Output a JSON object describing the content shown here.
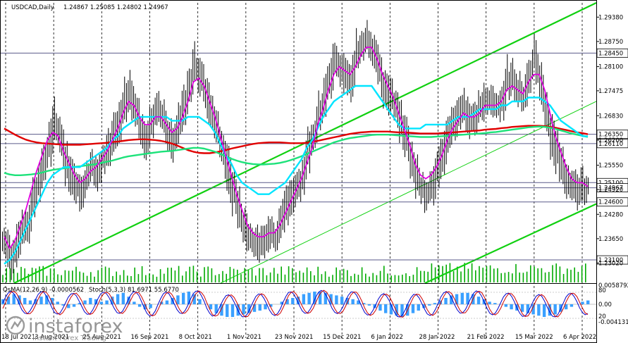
{
  "header": {
    "symbol": "USDCAD,Daily",
    "ohlc": "1.24867 1.25085 1.24802 1.24967"
  },
  "indicator_header": {
    "osma": "OsMA(12,26,9) -0.0000562",
    "stoch": "Stoch(5,3,3) 81.6971 55.6770"
  },
  "watermark": {
    "brand": "instaforex",
    "tagline": "Instant Forex Trading"
  },
  "colors": {
    "price_bar": "#000000",
    "ema_fast": "#e000e0",
    "ema_mid": "#00e5ff",
    "ema_slow_green": "#1de27a",
    "ema_200": "#e00000",
    "channel": "#10d010",
    "volume": "#00aa00",
    "osma": "#3aa0ff",
    "stoch_main": "#0000cc",
    "stoch_signal": "#d00000",
    "level_line": "#5a5a8a"
  },
  "chart_data": {
    "type": "candlestick",
    "title": "USDCAD,Daily",
    "ylim": [
      1.225,
      1.2975
    ],
    "y_ticks": [
      "1.29380",
      "1.28750",
      "1.28100",
      "1.27475",
      "1.26830",
      "1.26200",
      "1.25550",
      "1.24920",
      "1.24280",
      "1.23650",
      "1.23020"
    ],
    "level_labels": [
      "1.28450",
      "1.26350",
      "1.26110",
      "1.25100",
      "1.24967",
      "1.24600",
      "1.23100"
    ],
    "x_ticks": [
      "18 Jul 2021",
      "3 Aug 2021",
      "25 Aug 2021",
      "16 Sep 2021",
      "8 Oct 2021",
      "1 Nov 2021",
      "23 Nov 2021",
      "15 Dec 2021",
      "6 Jan 2022",
      "28 Jan 2022",
      "21 Feb 2022",
      "15 Mar 2022",
      "6 Apr 2022"
    ],
    "price_path": [
      1.236,
      1.231,
      1.234,
      1.238,
      1.24,
      1.246,
      1.25,
      1.255,
      1.26,
      1.266,
      1.264,
      1.258,
      1.253,
      1.251,
      1.248,
      1.252,
      1.255,
      1.254,
      1.257,
      1.26,
      1.263,
      1.266,
      1.271,
      1.274,
      1.27,
      1.266,
      1.262,
      1.266,
      1.27,
      1.268,
      1.264,
      1.262,
      1.266,
      1.27,
      1.275,
      1.281,
      1.279,
      1.275,
      1.27,
      1.266,
      1.261,
      1.256,
      1.25,
      1.246,
      1.241,
      1.238,
      1.236,
      1.235,
      1.236,
      1.238,
      1.237,
      1.241,
      1.244,
      1.247,
      1.25,
      1.252,
      1.258,
      1.262,
      1.268,
      1.272,
      1.277,
      1.282,
      1.281,
      1.279,
      1.277,
      1.283,
      1.286,
      1.288,
      1.286,
      1.282,
      1.277,
      1.274,
      1.272,
      1.268,
      1.264,
      1.259,
      1.254,
      1.25,
      1.248,
      1.249,
      1.254,
      1.258,
      1.263,
      1.266,
      1.268,
      1.27,
      1.267,
      1.268,
      1.27,
      1.272,
      1.272,
      1.271,
      1.272,
      1.277,
      1.278,
      1.275,
      1.273,
      1.278,
      1.283,
      1.279,
      1.272,
      1.265,
      1.26,
      1.256,
      1.253,
      1.25,
      1.249,
      1.25,
      1.25
    ],
    "ema_fast": [
      1.237,
      1.234,
      1.236,
      1.24,
      1.244,
      1.249,
      1.254,
      1.258,
      1.262,
      1.264,
      1.263,
      1.259,
      1.256,
      1.253,
      1.251,
      1.252,
      1.254,
      1.255,
      1.257,
      1.259,
      1.262,
      1.265,
      1.269,
      1.272,
      1.271,
      1.268,
      1.266,
      1.266,
      1.268,
      1.268,
      1.266,
      1.264,
      1.265,
      1.268,
      1.272,
      1.277,
      1.278,
      1.276,
      1.272,
      1.268,
      1.263,
      1.258,
      1.253,
      1.248,
      1.244,
      1.24,
      1.238,
      1.237,
      1.237,
      1.238,
      1.238,
      1.24,
      1.243,
      1.246,
      1.249,
      1.252,
      1.256,
      1.26,
      1.266,
      1.27,
      1.275,
      1.279,
      1.281,
      1.28,
      1.279,
      1.281,
      1.284,
      1.286,
      1.286,
      1.283,
      1.279,
      1.276,
      1.273,
      1.269,
      1.265,
      1.261,
      1.256,
      1.253,
      1.252,
      1.253,
      1.255,
      1.258,
      1.262,
      1.265,
      1.267,
      1.269,
      1.268,
      1.268,
      1.269,
      1.271,
      1.271,
      1.271,
      1.272,
      1.275,
      1.276,
      1.275,
      1.274,
      1.277,
      1.279,
      1.279,
      1.275,
      1.269,
      1.263,
      1.259,
      1.255,
      1.252,
      1.251,
      1.251,
      1.25
    ],
    "ema_mid": [
      1.23,
      1.231,
      1.233,
      1.236,
      1.239,
      1.242,
      1.245,
      1.248,
      1.251,
      1.253,
      1.254,
      1.255,
      1.255,
      1.255,
      1.255,
      1.256,
      1.257,
      1.258,
      1.259,
      1.26,
      1.262,
      1.263,
      1.265,
      1.266,
      1.267,
      1.268,
      1.268,
      1.268,
      1.268,
      1.268,
      1.268,
      1.267,
      1.267,
      1.267,
      1.268,
      1.268,
      1.268,
      1.267,
      1.266,
      1.264,
      1.261,
      1.258,
      1.256,
      1.253,
      1.251,
      1.25,
      1.249,
      1.248,
      1.248,
      1.248,
      1.249,
      1.25,
      1.251,
      1.253,
      1.255,
      1.257,
      1.26,
      1.262,
      1.265,
      1.268,
      1.27,
      1.272,
      1.273,
      1.274,
      1.275,
      1.276,
      1.276,
      1.276,
      1.276,
      1.274,
      1.272,
      1.27,
      1.268,
      1.266,
      1.265,
      1.265,
      1.265,
      1.265,
      1.266,
      1.266,
      1.266,
      1.266,
      1.266,
      1.267,
      1.268,
      1.268,
      1.268,
      1.269,
      1.27,
      1.27,
      1.27,
      1.27,
      1.271,
      1.271,
      1.272,
      1.272,
      1.272,
      1.273,
      1.273,
      1.273,
      1.272,
      1.271,
      1.269,
      1.267,
      1.266,
      1.265,
      1.264,
      1.263,
      1.263
    ],
    "ema_slow_green": [
      1.2535,
      1.2531,
      1.2529,
      1.2529,
      1.253,
      1.2531,
      1.2533,
      1.2536,
      1.254,
      1.2543,
      1.2545,
      1.2547,
      1.2549,
      1.2551,
      1.2552,
      1.2554,
      1.2556,
      1.2558,
      1.2561,
      1.2564,
      1.2567,
      1.2571,
      1.2575,
      1.2578,
      1.258,
      1.2582,
      1.2584,
      1.2586,
      1.2588,
      1.259,
      1.2591,
      1.2592,
      1.2594,
      1.2596,
      1.2598,
      1.26,
      1.26,
      1.2598,
      1.2594,
      1.259,
      1.2584,
      1.2578,
      1.2572,
      1.2567,
      1.2563,
      1.256,
      1.2558,
      1.2557,
      1.2557,
      1.2558,
      1.2559,
      1.2561,
      1.2564,
      1.2568,
      1.2573,
      1.2578,
      1.2584,
      1.259,
      1.2596,
      1.2602,
      1.2608,
      1.2614,
      1.2618,
      1.2622,
      1.2625,
      1.2627,
      1.2629,
      1.2631,
      1.2633,
      1.2634,
      1.2634,
      1.2634,
      1.2633,
      1.2632,
      1.2631,
      1.263,
      1.2629,
      1.2628,
      1.2628,
      1.2628,
      1.2629,
      1.263,
      1.2631,
      1.2632,
      1.2633,
      1.2634,
      1.2635,
      1.2636,
      1.2637,
      1.2638,
      1.264,
      1.2641,
      1.2643,
      1.2645,
      1.2647,
      1.2649,
      1.2651,
      1.2653,
      1.2654,
      1.2655,
      1.2654,
      1.2652,
      1.2649,
      1.2645,
      1.2641,
      1.2637,
      1.2634,
      1.2631,
      1.2628
    ],
    "ema_200": [
      1.265,
      1.2642,
      1.2634,
      1.2627,
      1.2621,
      1.2617,
      1.2614,
      1.2612,
      1.2611,
      1.261,
      1.2609,
      1.2608,
      1.2608,
      1.2608,
      1.2608,
      1.2609,
      1.261,
      1.2611,
      1.2612,
      1.2613,
      1.2615,
      1.2616,
      1.2618,
      1.262,
      1.2621,
      1.2622,
      1.2622,
      1.2621,
      1.262,
      1.2618,
      1.2615,
      1.2611,
      1.2606,
      1.26,
      1.2594,
      1.259,
      1.2587,
      1.2586,
      1.2586,
      1.2588,
      1.2591,
      1.2594,
      1.2598,
      1.2601,
      1.2604,
      1.2607,
      1.261,
      1.2612,
      1.2613,
      1.2614,
      1.2614,
      1.2614,
      1.2613,
      1.2612,
      1.2612,
      1.2612,
      1.2613,
      1.2615,
      1.2618,
      1.2621,
      1.2624,
      1.2627,
      1.263,
      1.2633,
      1.2636,
      1.2638,
      1.264,
      1.2641,
      1.2642,
      1.2642,
      1.2642,
      1.2642,
      1.2641,
      1.264,
      1.264,
      1.2639,
      1.2638,
      1.2637,
      1.2637,
      1.2637,
      1.2637,
      1.2638,
      1.2639,
      1.264,
      1.2641,
      1.2642,
      1.2643,
      1.2644,
      1.2645,
      1.2647,
      1.2648,
      1.2649,
      1.2651,
      1.2652,
      1.2654,
      1.2655,
      1.2656,
      1.2657,
      1.2657,
      1.2657,
      1.2656,
      1.2654,
      1.2652,
      1.2649,
      1.2646,
      1.2643,
      1.264,
      1.2638,
      1.2635
    ],
    "channel_upper": [
      [
        1.231,
        1.265
      ],
      [
        1.2975,
        1.2975
      ]
    ],
    "channel_lower_x": [
      0.37,
      0.99
    ],
    "channel_lower_y": [
      1.225,
      1.2455
    ],
    "channel_mid_y": [
      1.225,
      1.272
    ],
    "osma_values": [
      0.4,
      0.6,
      0.8,
      0.7,
      0.5,
      0.3,
      0.4,
      0.6,
      0.7,
      0.5,
      0.2,
      -0.1,
      -0.3,
      -0.2,
      0.1,
      0.3,
      0.5,
      0.4,
      0.2,
      0.3,
      0.6,
      0.8,
      0.9,
      0.6,
      0.2,
      -0.2,
      -0.4,
      -0.3,
      0.0,
      0.2,
      0.3,
      0.5,
      0.7,
      0.9,
      1.0,
      0.8,
      0.4,
      0.0,
      -0.4,
      -0.7,
      -0.9,
      -1.0,
      -1.0,
      -0.9,
      -0.8,
      -0.7,
      -0.6,
      -0.5,
      -0.4,
      -0.2,
      0.0,
      0.2,
      0.4,
      0.5,
      0.6,
      0.8,
      0.9,
      1.0,
      1.0,
      0.9,
      0.8,
      0.7,
      0.6,
      0.5,
      0.4,
      0.3,
      0.1,
      -0.1,
      -0.3,
      -0.5,
      -0.7,
      -0.8,
      -0.9,
      -1.0,
      -0.9,
      -0.7,
      -0.5,
      -0.3,
      -0.1,
      0.1,
      0.3,
      0.5,
      0.7,
      0.8,
      0.9,
      0.9,
      0.8,
      0.6,
      0.4,
      0.2,
      0.1,
      0.0,
      -0.2,
      -0.4,
      -0.5,
      -0.6,
      -0.7,
      -0.8,
      -0.9,
      -1.0,
      -0.9,
      -0.8,
      -0.6,
      -0.4,
      -0.2,
      0.0,
      0.2,
      0.3
    ]
  }
}
